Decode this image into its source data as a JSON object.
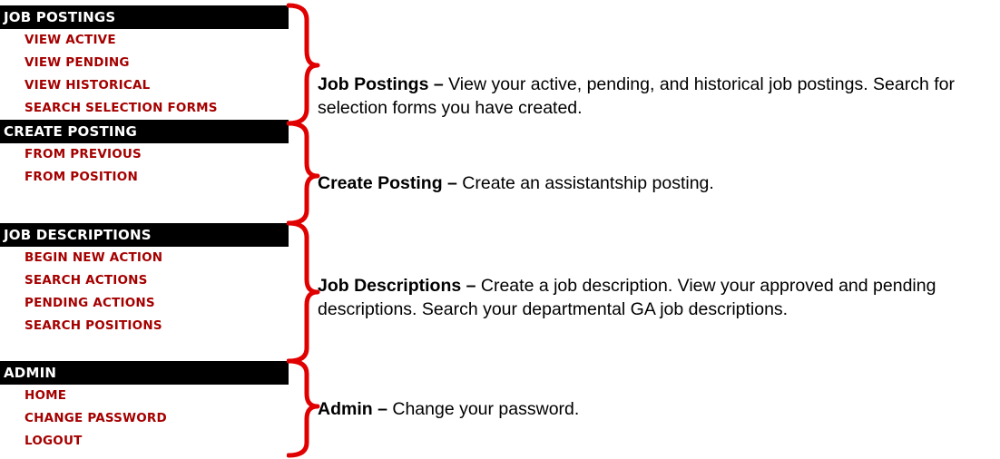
{
  "brace_color": "#e00000",
  "menu_item_color": "#a50000",
  "sections": [
    {
      "header": "JOB POSTINGS",
      "items": [
        "VIEW ACTIVE",
        "VIEW PENDING",
        "VIEW HISTORICAL",
        "SEARCH SELECTION FORMS"
      ],
      "desc_title": "Job Postings –",
      "desc_text": " View your active, pending, and historical job postings.  Search for selection forms you have created."
    },
    {
      "header": "CREATE POSTING",
      "items": [
        "FROM PREVIOUS",
        "FROM POSITION"
      ],
      "desc_title": "Create Posting –",
      "desc_text": " Create an assistantship posting."
    },
    {
      "header": "JOB DESCRIPTIONS",
      "items": [
        "BEGIN NEW ACTION",
        "SEARCH ACTIONS",
        "PENDING ACTIONS",
        "SEARCH POSITIONS"
      ],
      "desc_title": "Job Descriptions –",
      "desc_text": " Create a job description.  View your approved and pending descriptions.  Search your departmental GA job descriptions."
    },
    {
      "header": "ADMIN",
      "items": [
        "HOME",
        "CHANGE PASSWORD",
        "LOGOUT"
      ],
      "desc_title": "Admin –",
      "desc_text": " Change your password."
    }
  ]
}
